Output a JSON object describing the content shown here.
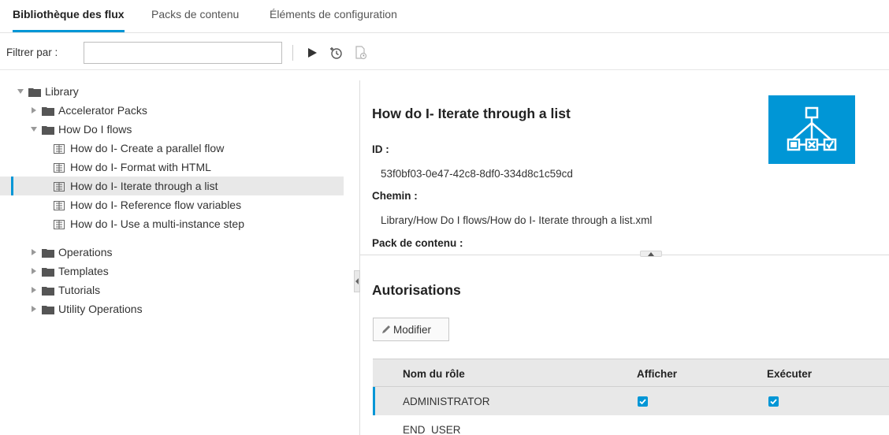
{
  "tabs": [
    {
      "label": "Bibliothèque des flux",
      "active": true
    },
    {
      "label": "Packs de contenu",
      "active": false
    },
    {
      "label": "Éléments de configuration",
      "active": false
    }
  ],
  "filter": {
    "label": "Filtrer par :",
    "value": ""
  },
  "toolbar": {
    "run": "play-icon",
    "schedule": "schedule-icon",
    "debug": "debug-icon"
  },
  "tree": {
    "root": "Library",
    "items": [
      {
        "label": "Accelerator Packs"
      },
      {
        "label": "How Do I flows"
      },
      {
        "label": "How do I- Create a parallel flow"
      },
      {
        "label": "How do I- Format with HTML"
      },
      {
        "label": "How do I- Iterate through a list"
      },
      {
        "label": "How do I- Reference flow variables"
      },
      {
        "label": "How do I- Use a multi-instance step"
      },
      {
        "label": "Operations"
      },
      {
        "label": "Templates"
      },
      {
        "label": "Tutorials"
      },
      {
        "label": "Utility Operations"
      }
    ]
  },
  "details": {
    "title": "How do I- Iterate through a list",
    "id_label": "ID :",
    "id_value": "53f0bf03-0e47-42c8-8df0-334d8c1c59cd",
    "path_label": "Chemin :",
    "path_value": "Library/How Do I flows/How do I- Iterate through a list.xml",
    "pack_label": "Pack de contenu :"
  },
  "permissions": {
    "title": "Autorisations",
    "edit_label": "Modifier",
    "columns": [
      "Nom du rôle",
      "Afficher",
      "Exécuter"
    ],
    "rows": [
      {
        "role": "ADMINISTRATOR",
        "view": true,
        "execute": true
      },
      {
        "role": "END_USER",
        "view": false,
        "execute": false
      }
    ]
  },
  "colors": {
    "accent": "#0096d6"
  }
}
